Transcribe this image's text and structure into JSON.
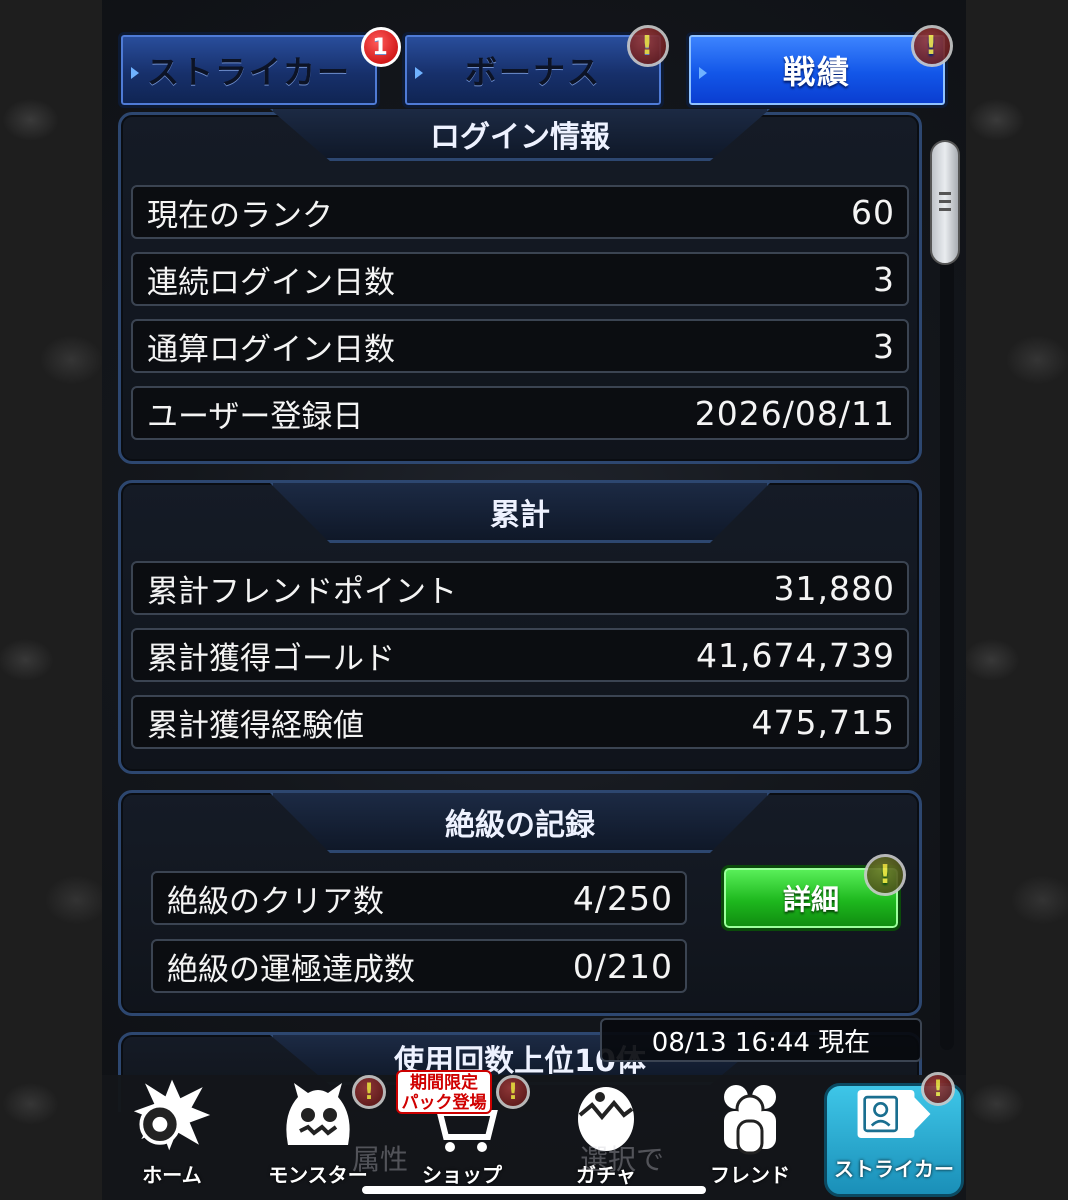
{
  "tabs": [
    {
      "label": "ストライカー",
      "badge": "1",
      "active": false
    },
    {
      "label": "ボーナス",
      "badge": "!",
      "active": false
    },
    {
      "label": "戦績",
      "badge": "!",
      "active": true
    }
  ],
  "login_section": {
    "title": "ログイン情報",
    "rows": [
      {
        "label": "現在のランク",
        "value": "60"
      },
      {
        "label": "連続ログイン日数",
        "value": "3"
      },
      {
        "label": "通算ログイン日数",
        "value": "3"
      },
      {
        "label": "ユーザー登録日",
        "value": "2026/08/11"
      }
    ]
  },
  "total_section": {
    "title": "累計",
    "rows": [
      {
        "label": "累計フレンドポイント",
        "value": "31,880"
      },
      {
        "label": "累計獲得ゴールド",
        "value": "41,674,739"
      },
      {
        "label": "累計獲得経験値",
        "value": "475,715"
      }
    ]
  },
  "zekkyu_section": {
    "title": "絶級の記録",
    "rows": [
      {
        "label": "絶級のクリア数",
        "value": "4/250"
      },
      {
        "label": "絶級の運極達成数",
        "value": "0/210"
      }
    ],
    "detail_button": "詳細",
    "detail_badge": "!"
  },
  "usage_section": {
    "title": "使用回数上位10体"
  },
  "timestamp": "08/13 16:44 現在",
  "ghost_text": {
    "left": "属性",
    "right": "選択で"
  },
  "promo_banner": {
    "line1": "期間限定",
    "line2": "パック登場"
  },
  "nav": [
    {
      "label": "ホーム",
      "icon": "home-burst-icon"
    },
    {
      "label": "モンスター",
      "icon": "monster-icon",
      "badge": "!"
    },
    {
      "label": "ショップ",
      "icon": "cart-icon",
      "badge": "!"
    },
    {
      "label": "ガチャ",
      "icon": "gacha-egg-icon"
    },
    {
      "label": "フレンド",
      "icon": "friends-icon"
    },
    {
      "label": "ストライカー",
      "icon": "striker-card-icon",
      "badge": "!",
      "active": true
    }
  ],
  "colors": {
    "tab_active": "#1256e8",
    "tab_inactive": "#17306b",
    "detail_button": "#1eb81e",
    "nav_active": "#2aa9d4"
  }
}
